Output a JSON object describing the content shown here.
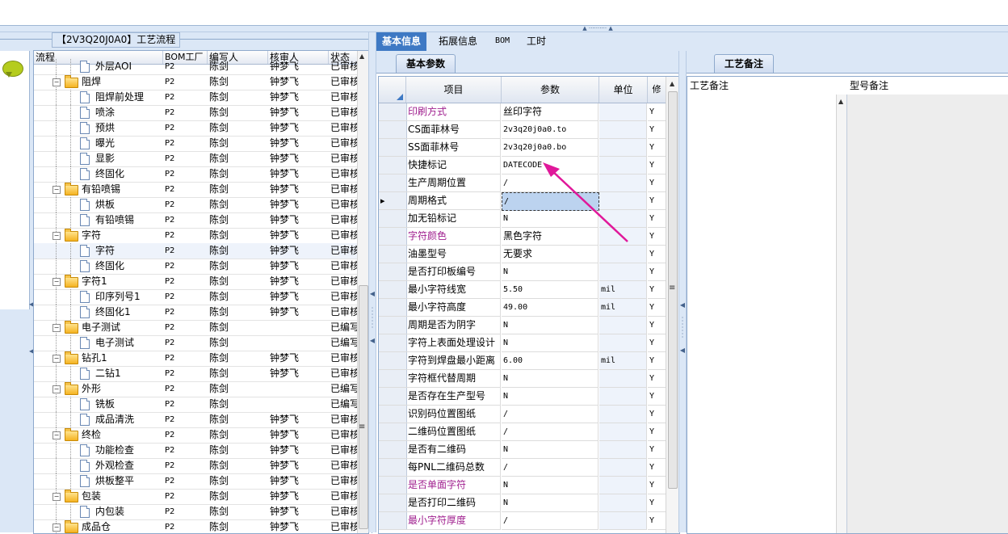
{
  "group_title": "【2V3Q20J0A0】工艺流程",
  "tree": {
    "headers": {
      "flow": "流程",
      "bom": "BOM工厂",
      "writer": "编写人",
      "reviewer": "核审人",
      "status": "状态"
    },
    "rows": [
      {
        "level": 1,
        "type": "doc",
        "label": "外层AOI",
        "bom": "P2",
        "writer": "陈剑",
        "reviewer": "钟梦飞",
        "status": "已审核"
      },
      {
        "level": 0,
        "type": "folder",
        "label": "阻焊",
        "bom": "P2",
        "writer": "陈剑",
        "reviewer": "钟梦飞",
        "status": "已审核"
      },
      {
        "level": 1,
        "type": "doc",
        "label": "阻焊前处理",
        "bom": "P2",
        "writer": "陈剑",
        "reviewer": "钟梦飞",
        "status": "已审核"
      },
      {
        "level": 1,
        "type": "doc",
        "label": "喷涂",
        "bom": "P2",
        "writer": "陈剑",
        "reviewer": "钟梦飞",
        "status": "已审核"
      },
      {
        "level": 1,
        "type": "doc",
        "label": "预烘",
        "bom": "P2",
        "writer": "陈剑",
        "reviewer": "钟梦飞",
        "status": "已审核"
      },
      {
        "level": 1,
        "type": "doc",
        "label": "曝光",
        "bom": "P2",
        "writer": "陈剑",
        "reviewer": "钟梦飞",
        "status": "已审核"
      },
      {
        "level": 1,
        "type": "doc",
        "label": "显影",
        "bom": "P2",
        "writer": "陈剑",
        "reviewer": "钟梦飞",
        "status": "已审核"
      },
      {
        "level": 1,
        "type": "doc",
        "label": "终固化",
        "bom": "P2",
        "writer": "陈剑",
        "reviewer": "钟梦飞",
        "status": "已审核"
      },
      {
        "level": 0,
        "type": "folder",
        "label": "有铅喷锡",
        "bom": "P2",
        "writer": "陈剑",
        "reviewer": "钟梦飞",
        "status": "已审核"
      },
      {
        "level": 1,
        "type": "doc",
        "label": "烘板",
        "bom": "P2",
        "writer": "陈剑",
        "reviewer": "钟梦飞",
        "status": "已审核"
      },
      {
        "level": 1,
        "type": "doc",
        "label": "有铅喷锡",
        "bom": "P2",
        "writer": "陈剑",
        "reviewer": "钟梦飞",
        "status": "已审核"
      },
      {
        "level": 0,
        "type": "folder",
        "label": "字符",
        "bom": "P2",
        "writer": "陈剑",
        "reviewer": "钟梦飞",
        "status": "已审核"
      },
      {
        "level": 1,
        "type": "doc",
        "label": "字符",
        "bom": "P2",
        "writer": "陈剑",
        "reviewer": "钟梦飞",
        "status": "已审核",
        "selected": true
      },
      {
        "level": 1,
        "type": "doc",
        "label": "终固化",
        "bom": "P2",
        "writer": "陈剑",
        "reviewer": "钟梦飞",
        "status": "已审核"
      },
      {
        "level": 0,
        "type": "folder",
        "label": "字符1",
        "bom": "P2",
        "writer": "陈剑",
        "reviewer": "钟梦飞",
        "status": "已审核"
      },
      {
        "level": 1,
        "type": "doc",
        "label": "印序列号1",
        "bom": "P2",
        "writer": "陈剑",
        "reviewer": "钟梦飞",
        "status": "已审核"
      },
      {
        "level": 1,
        "type": "doc",
        "label": "终固化1",
        "bom": "P2",
        "writer": "陈剑",
        "reviewer": "钟梦飞",
        "status": "已审核"
      },
      {
        "level": 0,
        "type": "folder",
        "label": "电子测试",
        "bom": "P2",
        "writer": "陈剑",
        "reviewer": "",
        "status": "已编写"
      },
      {
        "level": 1,
        "type": "doc",
        "label": "电子测试",
        "bom": "P2",
        "writer": "陈剑",
        "reviewer": "",
        "status": "已编写"
      },
      {
        "level": 0,
        "type": "folder",
        "label": "钻孔1",
        "bom": "P2",
        "writer": "陈剑",
        "reviewer": "钟梦飞",
        "status": "已审核"
      },
      {
        "level": 1,
        "type": "doc",
        "label": "二钻1",
        "bom": "P2",
        "writer": "陈剑",
        "reviewer": "钟梦飞",
        "status": "已审核"
      },
      {
        "level": 0,
        "type": "folder",
        "label": "外形",
        "bom": "P2",
        "writer": "陈剑",
        "reviewer": "",
        "status": "已编写"
      },
      {
        "level": 1,
        "type": "doc",
        "label": "铣板",
        "bom": "P2",
        "writer": "陈剑",
        "reviewer": "",
        "status": "已编写"
      },
      {
        "level": 1,
        "type": "doc",
        "label": "成品清洗",
        "bom": "P2",
        "writer": "陈剑",
        "reviewer": "钟梦飞",
        "status": "已审核"
      },
      {
        "level": 0,
        "type": "folder",
        "label": "终检",
        "bom": "P2",
        "writer": "陈剑",
        "reviewer": "钟梦飞",
        "status": "已审核"
      },
      {
        "level": 1,
        "type": "doc",
        "label": "功能检查",
        "bom": "P2",
        "writer": "陈剑",
        "reviewer": "钟梦飞",
        "status": "已审核"
      },
      {
        "level": 1,
        "type": "doc",
        "label": "外观检查",
        "bom": "P2",
        "writer": "陈剑",
        "reviewer": "钟梦飞",
        "status": "已审核"
      },
      {
        "level": 1,
        "type": "doc",
        "label": "烘板整平",
        "bom": "P2",
        "writer": "陈剑",
        "reviewer": "钟梦飞",
        "status": "已审核"
      },
      {
        "level": 0,
        "type": "folder",
        "label": "包装",
        "bom": "P2",
        "writer": "陈剑",
        "reviewer": "钟梦飞",
        "status": "已审核"
      },
      {
        "level": 1,
        "type": "doc",
        "label": "内包装",
        "bom": "P2",
        "writer": "陈剑",
        "reviewer": "钟梦飞",
        "status": "已审核"
      },
      {
        "level": 0,
        "type": "folder",
        "label": "成品仓",
        "bom": "P2",
        "writer": "陈剑",
        "reviewer": "钟梦飞",
        "status": "已审核"
      }
    ]
  },
  "tabs": [
    {
      "label": "基本信息",
      "active": true
    },
    {
      "label": "拓展信息"
    },
    {
      "label": "BOM"
    },
    {
      "label": "工时"
    }
  ],
  "sub_tab": "基本参数",
  "notes_tab": "工艺备注",
  "grid": {
    "headers": {
      "item": "项目",
      "param": "参数",
      "unit": "单位",
      "flag": "修"
    },
    "rows": [
      {
        "item": "印刷方式",
        "param": "丝印字符",
        "unit": "",
        "flag": "Y",
        "purple": true
      },
      {
        "item": "CS面菲林号",
        "param": "2v3q20j0a0.to",
        "unit": "",
        "flag": "Y"
      },
      {
        "item": "SS面菲林号",
        "param": "2v3q20j0a0.bo",
        "unit": "",
        "flag": "Y"
      },
      {
        "item": "快捷标记",
        "param": "DATECODE",
        "unit": "",
        "flag": "Y"
      },
      {
        "item": "生产周期位置",
        "param": "/",
        "unit": "",
        "flag": "Y"
      },
      {
        "item": "周期格式",
        "param": "/",
        "unit": "",
        "flag": "Y",
        "current": true
      },
      {
        "item": "加无铅标记",
        "param": "N",
        "unit": "",
        "flag": "Y"
      },
      {
        "item": "字符颜色",
        "param": "黑色字符",
        "unit": "",
        "flag": "Y",
        "purple": true
      },
      {
        "item": "油墨型号",
        "param": "无要求",
        "unit": "",
        "flag": "Y"
      },
      {
        "item": "是否打印板编号",
        "param": "N",
        "unit": "",
        "flag": "Y"
      },
      {
        "item": "最小字符线宽",
        "param": "5.50",
        "unit": "mil",
        "flag": "Y"
      },
      {
        "item": "最小字符高度",
        "param": "49.00",
        "unit": "mil",
        "flag": "Y"
      },
      {
        "item": "周期是否为阴字",
        "param": "N",
        "unit": "",
        "flag": "Y"
      },
      {
        "item": "字符上表面处理设计",
        "param": "N",
        "unit": "",
        "flag": "Y"
      },
      {
        "item": "字符到焊盘最小距离",
        "param": "6.00",
        "unit": "mil",
        "flag": "Y"
      },
      {
        "item": "字符框代替周期",
        "param": "N",
        "unit": "",
        "flag": "Y"
      },
      {
        "item": "是否存在生产型号",
        "param": "N",
        "unit": "",
        "flag": "Y"
      },
      {
        "item": "识别码位置图纸",
        "param": "/",
        "unit": "",
        "flag": "Y"
      },
      {
        "item": "二维码位置图纸",
        "param": "/",
        "unit": "",
        "flag": "Y"
      },
      {
        "item": "是否有二维码",
        "param": "N",
        "unit": "",
        "flag": "Y"
      },
      {
        "item": "每PNL二维码总数",
        "param": "/",
        "unit": "",
        "flag": "Y"
      },
      {
        "item": "是否单面字符",
        "param": "N",
        "unit": "",
        "flag": "Y",
        "purple": true
      },
      {
        "item": "是否打印二维码",
        "param": "N",
        "unit": "",
        "flag": "Y"
      },
      {
        "item": "最小字符厚度",
        "param": "/",
        "unit": "",
        "flag": "Y",
        "purple": true
      }
    ]
  },
  "notes": {
    "process_note": "工艺备注",
    "model_note": "型号备注"
  },
  "colors": {
    "accent": "#3e79c4",
    "purple_label": "#a0208f",
    "annotation_arrow": "#e0189a",
    "panel_bg": "#dbe7f6"
  },
  "icons": {
    "chat": "speech-bubble-icon",
    "folder": "folder-icon",
    "document": "document-icon"
  }
}
